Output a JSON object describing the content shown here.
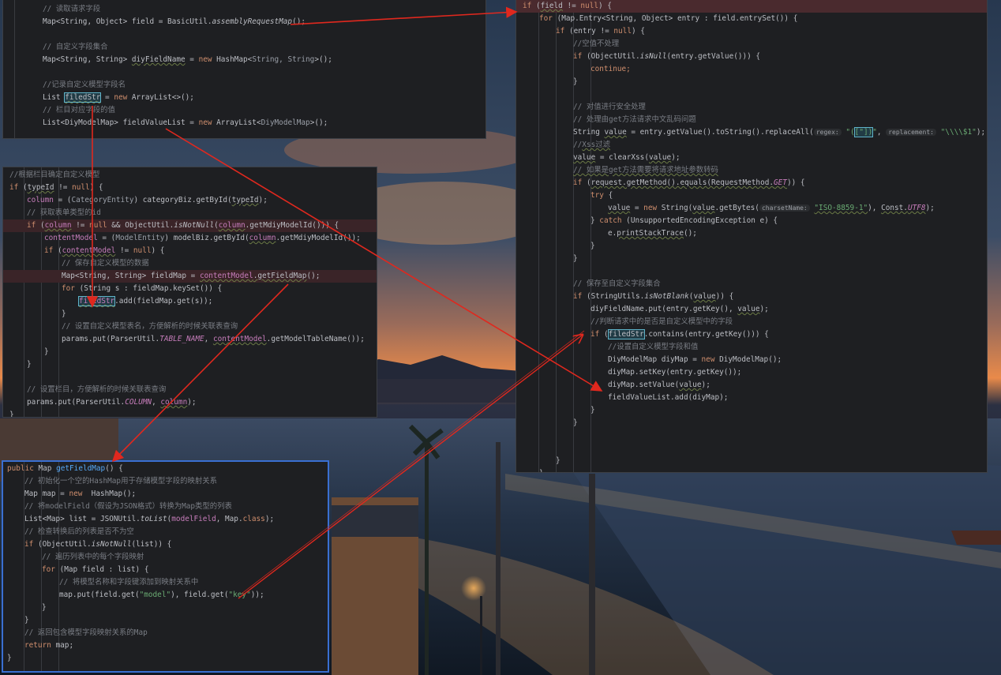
{
  "colors": {
    "panel_bg": "#1e1f22",
    "keyword": "#cf8e6d",
    "comment": "#7a7e85",
    "string": "#6aab73",
    "function": "#56a8f5",
    "arrow": "#e0281e",
    "highlight_line": "#3a2428"
  },
  "panel_a": {
    "l1": "// 读取请求字段",
    "l2a": "Map<String, Object> field = BasicUtil.",
    "l2b": "assemblyRequestMap",
    "l2c": "();",
    "l3": "// 自定义字段集合",
    "l4a": "Map<String, String> ",
    "l4b": "diyFieldName",
    "l4c": " = ",
    "l4d": "new",
    "l4e": " HashMap<",
    "l4f": "String, String",
    "l4g": ">();",
    "l5": "//记录自定义模型字段名",
    "l6a": "List ",
    "l6b": "filedStr",
    "l6c": " = ",
    "l6d": "new",
    "l6e": " ArrayList<>();",
    "l7": "// 栏目对应字段的值",
    "l8a": "List<DiyModelMap> fieldValueList = ",
    "l8b": "new",
    "l8c": " ArrayList<",
    "l8d": "DiyModelMap",
    "l8e": ">();"
  },
  "panel_b": {
    "l1": "//根据栏目确定自定义模型",
    "l2a": "if",
    "l2b": " (",
    "l2c": "typeId",
    "l2d": " != ",
    "l2e": "null",
    "l2f": ") {",
    "l3a": "column",
    "l3b": " = (",
    "l3c": "CategoryEntity",
    "l3d": ") categoryBiz.getById(",
    "l3e": "typeId",
    "l3f": ");",
    "l4": "// 获取表单类型的id",
    "l5a": "if",
    "l5b": " (",
    "l5c": "column",
    "l5d": " != ",
    "l5e": "null",
    "l5f": " && ObjectUtil.",
    "l5g": "isNotNull",
    "l5h": "(",
    "l5i": "column",
    "l5j": ".getMdiyModelId())) {",
    "l6a": "contentModel",
    "l6b": " = (",
    "l6c": "ModelEntity",
    "l6d": ") modelBiz.getById(",
    "l6e": "column",
    "l6f": ".getMdiyModelId());",
    "l7a": "if",
    "l7b": " (",
    "l7c": "contentModel",
    "l7d": " != ",
    "l7e": "null",
    "l7f": ") {",
    "l8": "// 保存自定义模型的数据",
    "l9a": "Map<String, String> fieldMap = ",
    "l9b": "contentModel",
    "l9c": ".getFieldMap",
    "l9d": "();",
    "l10a": "for",
    "l10b": " (String s : fieldMap.keySet()) {",
    "l11a": "filedStr",
    "l11b": ".add(fieldMap.get(s));",
    "l12": "}",
    "l13": "// 设置自定义模型表名，方便解析的时候关联表查询",
    "l14a": "params.put(ParserUtil.",
    "l14b": "TABLE_NAME",
    "l14c": ", ",
    "l14d": "contentModel",
    "l14e": ".getModelTableName());",
    "l15": "}",
    "l16": "}",
    "l17": "// 设置栏目，方便解析的时候关联表查询",
    "l18a": "params.put(ParserUtil.",
    "l18b": "COLUMN",
    "l18c": ", ",
    "l18d": "column",
    "l18e": ");",
    "l19": "}"
  },
  "panel_c": {
    "l1a": "public",
    "l1b": " Map ",
    "l1c": "getFieldMap",
    "l1d": "() {",
    "l2": "// 初始化一个空的HashMap用于存储模型字段的映射关系",
    "l3a": "Map map = ",
    "l3b": "new",
    "l3c": "  HashMap();",
    "l4": "// 将modelField（假设为JSON格式）转换为Map类型的列表",
    "l5a": "List<Map> list = JSONUtil.",
    "l5b": "toList",
    "l5c": "(",
    "l5d": "modelField",
    "l5e": ", Map.",
    "l5f": "class",
    "l5g": ");",
    "l6": "// 检查转换后的列表是否不为空",
    "l7a": "if",
    "l7b": " (ObjectUtil.",
    "l7c": "isNotNull",
    "l7d": "(list)) {",
    "l8": "// 遍历列表中的每个字段映射",
    "l9a": "for",
    "l9b": " (Map field : list) {",
    "l10": "// 将模型名称和字段键添加到映射关系中",
    "l11a": "map.put(field.get(",
    "l11b": "\"model\"",
    "l11c": "), field.get(",
    "l11d": "\"key\"",
    "l11e": "));",
    "l12": "}",
    "l13": "}",
    "l14": "// 返回包含模型字段映射关系的Map",
    "l15a": "return",
    "l15b": " map;",
    "l16": "}"
  },
  "panel_d": {
    "l1a": "if",
    "l1b": " (",
    "l1c": "field",
    "l1d": " != ",
    "l1e": "null",
    "l1f": ") {",
    "l2a": "for",
    "l2b": " (Map.Entry<String, Object> entry : field.entrySet()) {",
    "l3a": "if",
    "l3b": " (entry != ",
    "l3c": "null",
    "l3d": ") {",
    "l4": "//空值不处理",
    "l5a": "if",
    "l5b": " (ObjectUtil.",
    "l5c": "isNull",
    "l5d": "(entry.getValue())) {",
    "l6": "continue;",
    "l7": "}",
    "l8": "// 对值进行安全处理",
    "l9": "// 处理由get方法请求中文乱码问题",
    "l10a": "String ",
    "l10b": "value",
    "l10c": " = entry.getValue().toString().replaceAll(",
    "l10d": "regex:",
    "l10e": "\"(",
    "l10f": "[\"])",
    "l10g": "\"",
    "l10h": ", ",
    "l10i": "replacement:",
    "l10j": "\"\\\\\\\\$1\"",
    "l10k": ");",
    "l11a": "//",
    "l11b": "Xss过滤",
    "l12a": "value",
    "l12b": " = clearXss(",
    "l12c": "value",
    "l12d": ");",
    "l13": "// 如果是get方法需要将请求地址参数转码",
    "l14a": "if",
    "l14b": " (",
    "l14c": "request.getMethod().equals(RequestMethod.",
    "l14d": "GET",
    "l14e": ")) {",
    "l15a": "try",
    "l15b": " {",
    "l16a": "value",
    "l16b": " = ",
    "l16c": "new",
    "l16d": " String(",
    "l16e": "value",
    "l16f": ".getBytes(",
    "l16g": "charsetName:",
    "l16h": "\"ISO-8859-1\"",
    "l16i": "), ",
    "l16j": "Const.",
    "l16k": "UTF8",
    "l16l": ");",
    "l17a": "} ",
    "l17b": "catch",
    "l17c": " (UnsupportedEncodingException e) {",
    "l18a": "e.",
    "l18b": "printStackTrace",
    "l18c": "();",
    "l19": "}",
    "l20": "}",
    "l21": "// 保存至自定义字段集合",
    "l22a": "if",
    "l22b": " (StringUtils.",
    "l22c": "isNotBlank",
    "l22d": "(",
    "l22e": "value",
    "l22f": ")) {",
    "l23a": "diyFieldName.put(entry.getKey(), ",
    "l23b": "value",
    "l23c": ");",
    "l24": "//判断请求中的是否是自定义模型中的字段",
    "l25a": "if",
    "l25b": " (",
    "l25c": "filedStr",
    "l25d": ".contains(entry.getKey())) {",
    "l26": "//设置自定义模型字段和值",
    "l27a": "DiyModelMap diyMap = ",
    "l27b": "new",
    "l27c": " DiyModelMap();",
    "l28": "diyMap.setKey(entry.getKey());",
    "l29a": "diyMap.setValue(",
    "l29b": "value",
    "l29c": ");",
    "l30": "fieldValueList.add(diyMap);",
    "l31": "}",
    "l32": "}",
    "l33": "}",
    "l34": "}",
    "l35": "}"
  }
}
